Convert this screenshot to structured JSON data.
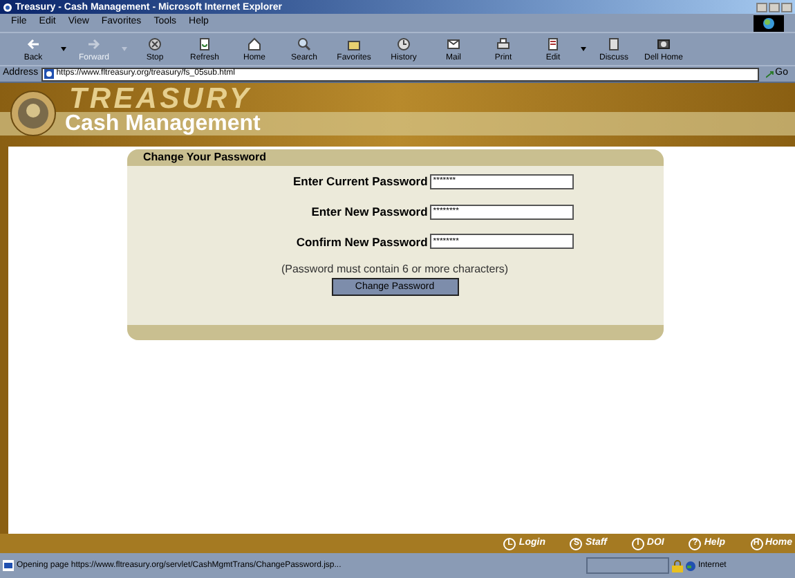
{
  "window": {
    "title": "Treasury - Cash Management - Microsoft Internet Explorer"
  },
  "menu": [
    "File",
    "Edit",
    "View",
    "Favorites",
    "Tools",
    "Help"
  ],
  "toolbar": [
    {
      "label": "Back",
      "kind": "back",
      "disabled": false,
      "dropdown": true
    },
    {
      "label": "Forward",
      "kind": "forward",
      "disabled": true,
      "dropdown": true
    },
    {
      "label": "Stop",
      "kind": "stop",
      "disabled": false,
      "dropdown": false
    },
    {
      "label": "Refresh",
      "kind": "refresh",
      "disabled": false,
      "dropdown": false
    },
    {
      "label": "Home",
      "kind": "home",
      "disabled": false,
      "dropdown": false
    },
    {
      "label": "Search",
      "kind": "search",
      "disabled": false,
      "dropdown": false
    },
    {
      "label": "Favorites",
      "kind": "favorites",
      "disabled": false,
      "dropdown": false
    },
    {
      "label": "History",
      "kind": "history",
      "disabled": false,
      "dropdown": false
    },
    {
      "label": "Mail",
      "kind": "mail",
      "disabled": false,
      "dropdown": false
    },
    {
      "label": "Print",
      "kind": "print",
      "disabled": false,
      "dropdown": false
    },
    {
      "label": "Edit",
      "kind": "edit",
      "disabled": false,
      "dropdown": true
    },
    {
      "label": "Discuss",
      "kind": "discuss",
      "disabled": false,
      "dropdown": false
    },
    {
      "label": "Dell Home",
      "kind": "dell",
      "disabled": false,
      "dropdown": false
    }
  ],
  "address": {
    "label": "Address",
    "value": "https://www.fltreasury.org/treasury/fs_05sub.html",
    "go": "Go"
  },
  "banner": {
    "watermark": "TREASURY",
    "title": "Cash Management"
  },
  "form": {
    "title": "Change Your Password",
    "fields": [
      {
        "label": "Enter Current Password",
        "value": "*******"
      },
      {
        "label": "Enter New Password",
        "value": "********"
      },
      {
        "label": "Confirm New Password",
        "value": "********"
      }
    ],
    "note": "(Password must contain 6 or more characters)",
    "button": "Change Password"
  },
  "footer_links": [
    {
      "icon_letter": "L",
      "label": "Login"
    },
    {
      "icon_letter": "S",
      "label": "Staff"
    },
    {
      "icon_letter": "I",
      "label": "DOI"
    },
    {
      "icon_letter": "?",
      "label": "Help"
    },
    {
      "icon_letter": "H",
      "label": "Home"
    }
  ],
  "status_bar": {
    "text": "Opening page https://www.fltreasury.org/servlet/CashMgmtTrans/ChangePassword.jsp...",
    "zone": "Internet"
  }
}
